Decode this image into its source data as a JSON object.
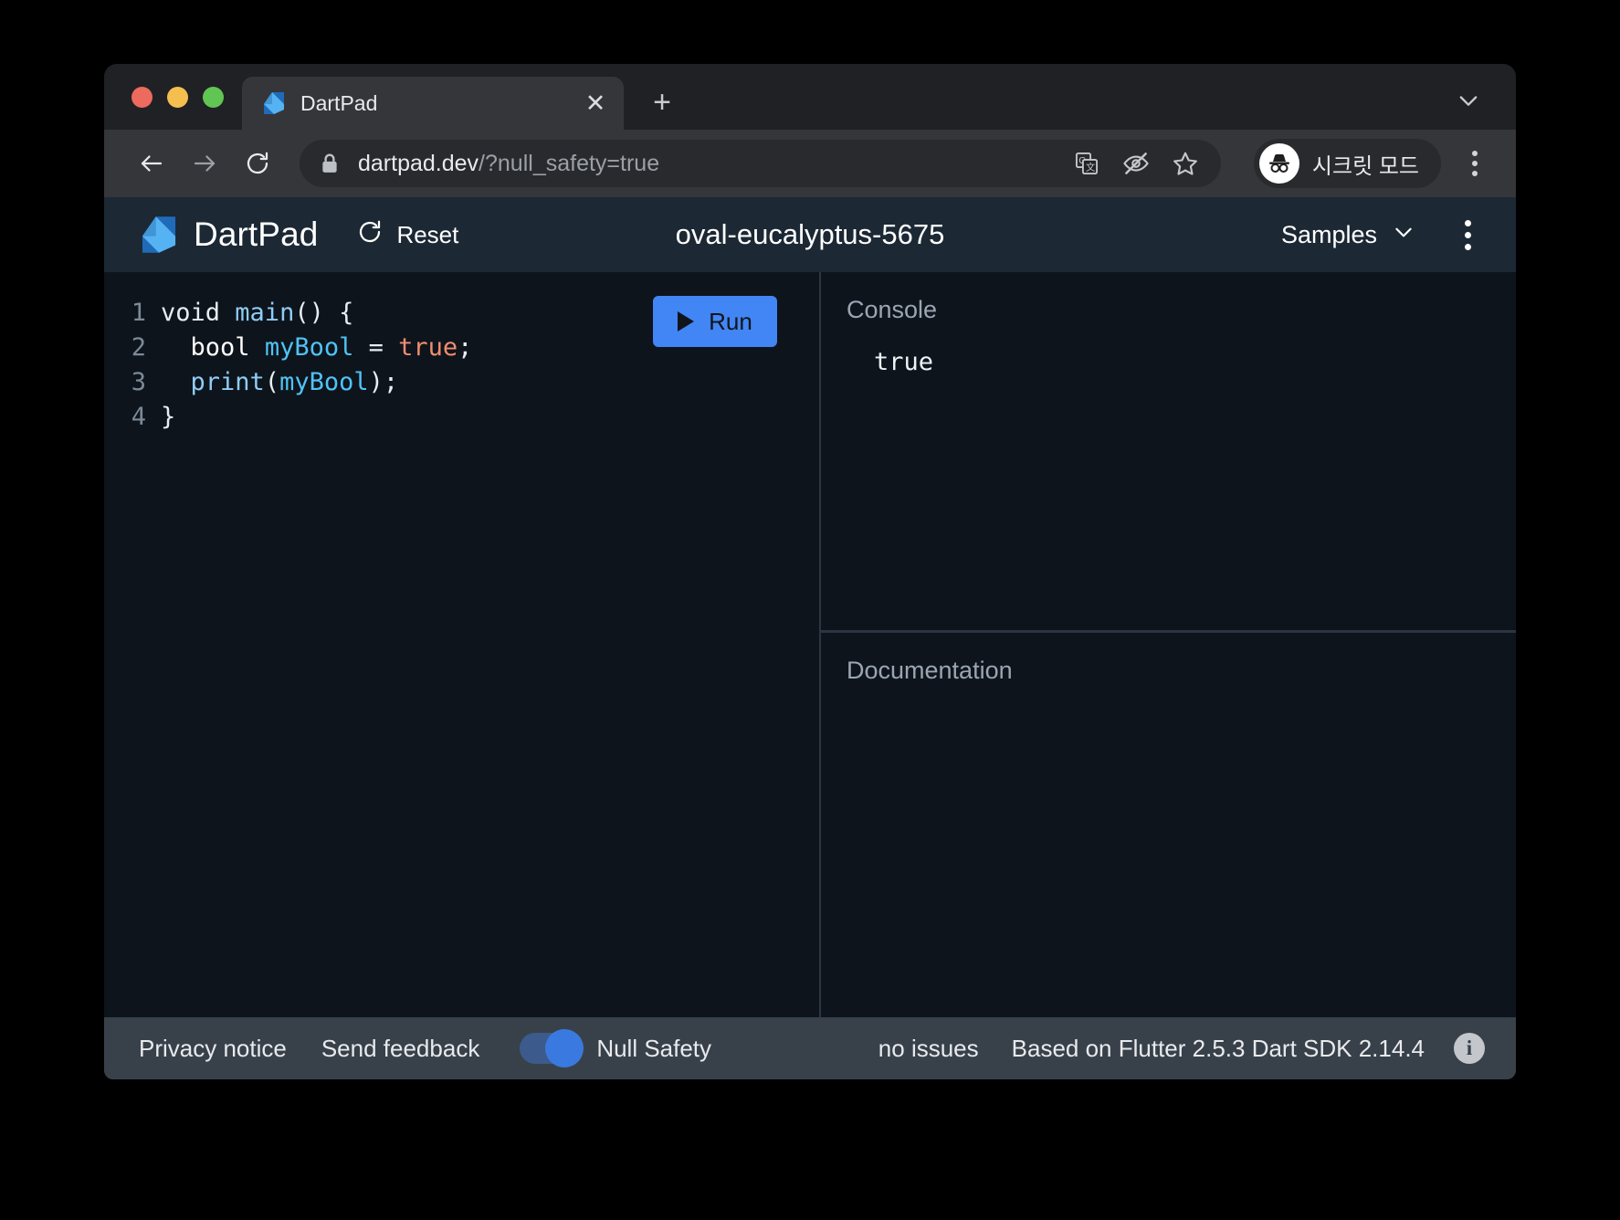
{
  "browser": {
    "traffic_lights": [
      "close",
      "minimize",
      "zoom"
    ],
    "tab": {
      "title": "DartPad",
      "favicon": "dart-logo-icon",
      "close_label": "✕"
    },
    "new_tab_label": "+",
    "toolbar": {
      "back_icon": "back-arrow-icon",
      "forward_icon": "forward-arrow-icon",
      "reload_icon": "reload-icon",
      "lock_icon": "lock-icon",
      "url_host": "dartpad.dev",
      "url_path": "/?null_safety=true",
      "translate_icon": "translate-icon",
      "eye_off_icon": "eye-off-icon",
      "bookmark_icon": "star-icon",
      "profile_label": "시크릿 모드",
      "menu_icon": "kebab-menu-icon"
    }
  },
  "dartpad": {
    "brand": "DartPad",
    "reset_label": "Reset",
    "reset_icon": "refresh-icon",
    "title": "oval-eucalyptus-5675",
    "samples_label": "Samples",
    "samples_chevron": "chevron-down-icon",
    "more_icon": "kebab-menu-icon",
    "run_label": "Run",
    "editor": {
      "lines": [
        {
          "num": "1",
          "tokens": [
            {
              "t": "void",
              "c": "tok-kw"
            },
            {
              "t": " ",
              "c": "tok-punc"
            },
            {
              "t": "main",
              "c": "tok-fn"
            },
            {
              "t": "() {",
              "c": "tok-punc"
            }
          ]
        },
        {
          "num": "2",
          "tokens": [
            {
              "t": "  bool",
              "c": "tok-type"
            },
            {
              "t": " ",
              "c": "tok-punc"
            },
            {
              "t": "myBool",
              "c": "tok-var"
            },
            {
              "t": " = ",
              "c": "tok-punc"
            },
            {
              "t": "true",
              "c": "tok-lit"
            },
            {
              "t": ";",
              "c": "tok-punc"
            }
          ]
        },
        {
          "num": "3",
          "tokens": [
            {
              "t": "  ",
              "c": "tok-punc"
            },
            {
              "t": "print",
              "c": "tok-fn"
            },
            {
              "t": "(",
              "c": "tok-punc"
            },
            {
              "t": "myBool",
              "c": "tok-var"
            },
            {
              "t": ");",
              "c": "tok-punc"
            }
          ]
        },
        {
          "num": "4",
          "tokens": [
            {
              "t": "}",
              "c": "tok-punc"
            }
          ]
        }
      ],
      "source_text": "void main() {\n  bool myBool = true;\n  print(myBool);\n}"
    },
    "console": {
      "label": "Console",
      "output": "true"
    },
    "documentation": {
      "label": "Documentation",
      "content": ""
    },
    "footer": {
      "privacy_label": "Privacy notice",
      "feedback_label": "Send feedback",
      "null_safety_label": "Null Safety",
      "null_safety_on": true,
      "issues_label": "no issues",
      "version_label": "Based on Flutter 2.5.3 Dart SDK 2.14.4",
      "info_icon": "info-icon",
      "info_glyph": "i"
    }
  },
  "colors": {
    "accent_blue": "#4285f4",
    "toggle_on": "#3a7ae0",
    "dartpad_header_bg": "#1c2834",
    "editor_bg": "#0e141b",
    "footer_bg": "#38414a",
    "literal_orange": "#f08d70",
    "identifier_blue": "#4fc3f7"
  }
}
